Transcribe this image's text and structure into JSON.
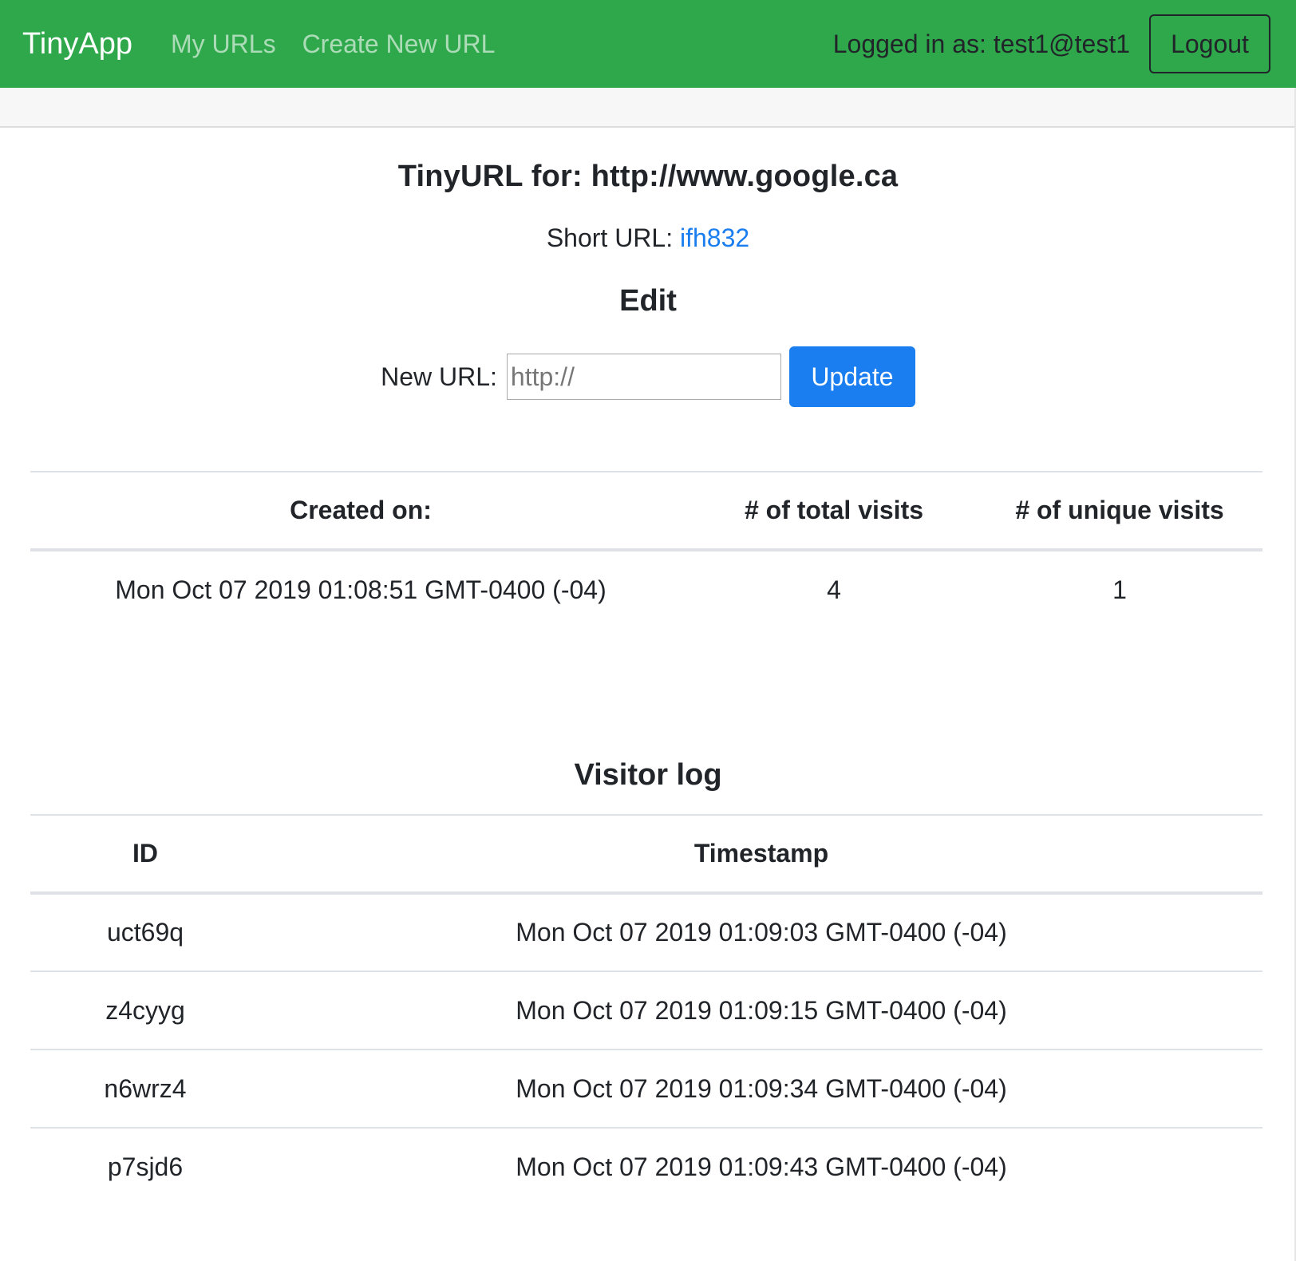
{
  "navbar": {
    "brand": "TinyApp",
    "links": [
      "My URLs",
      "Create New URL"
    ],
    "logged_in_text": "Logged in as: test1@test1",
    "logout_label": "Logout",
    "color": "#2fa84b"
  },
  "url_page": {
    "title": "TinyURL for: http://www.google.ca",
    "short_url_label": "Short URL: ",
    "short_url_value": "ifh832",
    "edit_heading": "Edit",
    "new_url_label": "New URL:",
    "new_url_placeholder": "http://",
    "update_label": "Update"
  },
  "stats": {
    "headers": [
      "Created on:",
      "# of total visits",
      "# of unique visits"
    ],
    "row": {
      "created": "Mon Oct 07 2019 01:08:51 GMT-0400 (-04)",
      "total_visits": "4",
      "unique_visits": "1"
    }
  },
  "visitor_log": {
    "heading": "Visitor log",
    "headers": [
      "ID",
      "Timestamp"
    ],
    "rows": [
      {
        "id": "uct69q",
        "timestamp": "Mon Oct 07 2019 01:09:03 GMT-0400 (-04)"
      },
      {
        "id": "z4cyyg",
        "timestamp": "Mon Oct 07 2019 01:09:15 GMT-0400 (-04)"
      },
      {
        "id": "n6wrz4",
        "timestamp": "Mon Oct 07 2019 01:09:34 GMT-0400 (-04)"
      },
      {
        "id": "p7sjd6",
        "timestamp": "Mon Oct 07 2019 01:09:43 GMT-0400 (-04)"
      }
    ]
  },
  "colors": {
    "primary_button": "#1a7ef0",
    "link": "#1a7ef0"
  }
}
